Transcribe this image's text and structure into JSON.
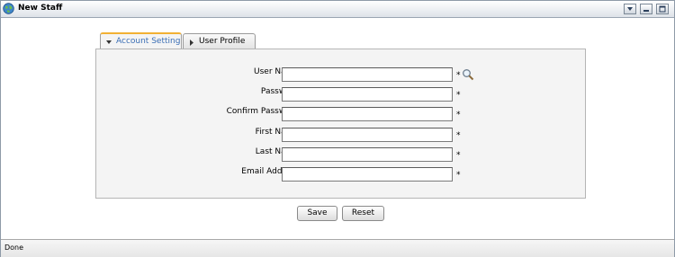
{
  "window": {
    "title": "New Staff",
    "controls": [
      "dropdown-icon",
      "minimize-icon",
      "maximize-icon"
    ]
  },
  "tabs": [
    {
      "label": "Account Setting",
      "active": true,
      "icon": "chevron-down-icon"
    },
    {
      "label": "User Profile",
      "active": false,
      "icon": "chevron-right-icon"
    }
  ],
  "form": {
    "fields": [
      {
        "label": "User Name:",
        "value": "",
        "required": "*",
        "lookup_icon": "search-icon"
      },
      {
        "label": "Password:",
        "value": "",
        "required": "*"
      },
      {
        "label": "Confirm Password:",
        "value": "",
        "required": "*"
      },
      {
        "label": "First Name:",
        "value": "",
        "required": "*"
      },
      {
        "label": "Last Name:",
        "value": "",
        "required": "*"
      },
      {
        "label": "Email Address:",
        "value": "",
        "required": "*"
      }
    ]
  },
  "buttons": {
    "save": "Save",
    "reset": "Reset"
  },
  "status": {
    "text": "Done"
  },
  "colors": {
    "active_tab_accent": "#f2b134",
    "active_tab_text": "#3a6eb5",
    "panel_bg": "#f4f4f4"
  }
}
